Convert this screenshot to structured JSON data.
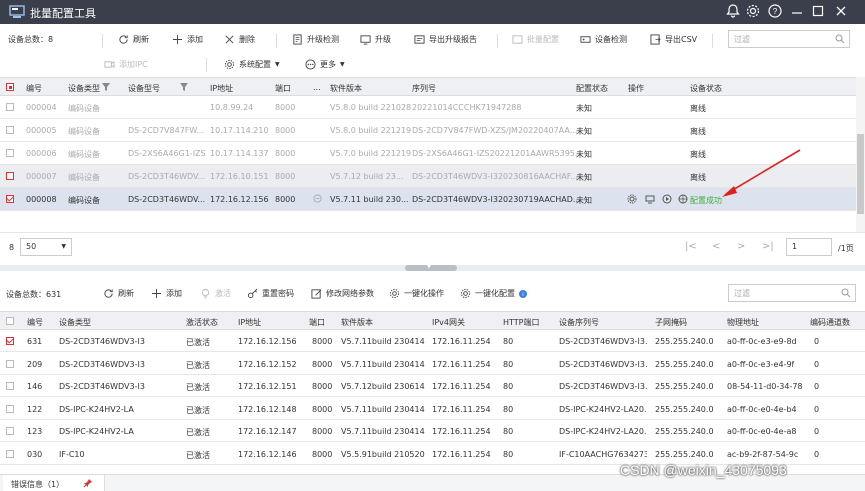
{
  "app": {
    "title": "批量配置工具"
  },
  "toolbar1": {
    "device_total_label": "设备总数：8",
    "refresh": "刷新",
    "add": "添加",
    "delete": "删除",
    "upgrade_check": "升级检测",
    "upgrade": "升级",
    "export_upgrade_report": "导出升级报告",
    "batch_config": "批量配置",
    "device_check": "设备检测",
    "export_csv": "导出CSV",
    "filter_placeholder": "过滤",
    "add_ipc": "添加IPC",
    "system_config": "系统配置",
    "more": "更多"
  },
  "table1": {
    "headers": [
      "编号",
      "设备类型",
      "设备型号",
      "IP地址",
      "端口",
      "...",
      "软件版本",
      "序列号",
      "配置状态",
      "操作",
      "设备状态"
    ],
    "rows": [
      {
        "id": "000004",
        "type": "编码设备",
        "model": "",
        "ip": "10.8.99.24",
        "port": "8000",
        "version": "V5.8.0 build 221028",
        "serial": "20221014CCCHK71947288",
        "config": "未知",
        "status": "离线"
      },
      {
        "id": "000005",
        "type": "编码设备",
        "model": "DS-2CD7V847FW...",
        "ip": "10.17.114.210",
        "port": "8000",
        "version": "V5.8.0 build 221219",
        "serial": "DS-2CD7V847FWD-XZS/JM20220407AA...",
        "config": "未知",
        "status": "离线"
      },
      {
        "id": "000006",
        "type": "编码设备",
        "model": "DS-2XS6A46G1-IZS",
        "ip": "10.17.114.137",
        "port": "8000",
        "version": "V5.7.0 build 221219",
        "serial": "DS-2XS6A46G1-IZS20221201AAWR5395...",
        "config": "未知",
        "status": "离线"
      },
      {
        "id": "000007",
        "type": "编码设备",
        "model": "DS-2CD3T46WDV...",
        "ip": "172.16.10.151",
        "port": "8000",
        "version": "V5.7.12 build 23...",
        "serial": "DS-2CD3T46WDV3-I320230816AACHAF...",
        "config": "未知",
        "status": "离线"
      },
      {
        "id": "000008",
        "type": "编码设备",
        "model": "DS-2CD3T46WDV...",
        "ip": "172.16.12.156",
        "port": "8000",
        "version": "V5.7.11 build 230...",
        "serial": "DS-2CD3T46WDV3-I320230719AACHAD...",
        "config": "未知",
        "status": "配置成功"
      }
    ]
  },
  "pager": {
    "page_size": "50",
    "count": "8",
    "page_input": "1",
    "total_pages": "/1页"
  },
  "toolbar2": {
    "device_total_label": "设备总数：631",
    "refresh": "刷新",
    "add": "添加",
    "activate": "激活",
    "reset_password": "重置密码",
    "modify_network": "修改网络参数",
    "one_key_op": "一键化操作",
    "one_key_config": "一键化配置",
    "filter_placeholder": "过滤"
  },
  "table2": {
    "headers": [
      "编号",
      "设备类型",
      "激活状态",
      "IP地址",
      "端口",
      "软件版本",
      "IPv4网关",
      "HTTP端口",
      "设备序列号",
      "子网掩码",
      "物理地址",
      "编码通道数"
    ],
    "rows": [
      {
        "id": "631",
        "type": "DS-2CD3T46WDV3-I3",
        "act": "已激活",
        "ip": "172.16.12.156",
        "port": "8000",
        "ver": "V5.7.11build 230414",
        "gw": "172.16.11.254",
        "http": "80",
        "serial": "DS-2CD3T46WDV3-I3...",
        "mask": "255.255.240.0",
        "mac": "a0-ff-0c-e3-e9-8d",
        "ch": "0"
      },
      {
        "id": "209",
        "type": "DS-2CD3T46WDV3-I3",
        "act": "已激活",
        "ip": "172.16.12.152",
        "port": "8000",
        "ver": "V5.7.11build 230414",
        "gw": "172.16.11.254",
        "http": "80",
        "serial": "DS-2CD3T46WDV3-I3...",
        "mask": "255.255.240.0",
        "mac": "a0-ff-0c-e3-e4-9f",
        "ch": "0"
      },
      {
        "id": "146",
        "type": "DS-2CD3T46WDV3-I3",
        "act": "已激活",
        "ip": "172.16.12.151",
        "port": "8000",
        "ver": "V5.7.12build 230614",
        "gw": "172.16.11.254",
        "http": "80",
        "serial": "DS-2CD3T46WDV3-I3...",
        "mask": "255.255.240.0",
        "mac": "08-54-11-d0-34-78",
        "ch": "0"
      },
      {
        "id": "122",
        "type": "DS-IPC-K24HV2-LA",
        "act": "已激活",
        "ip": "172.16.12.148",
        "port": "8000",
        "ver": "V5.7.11build 230414",
        "gw": "172.16.11.254",
        "http": "80",
        "serial": "DS-IPC-K24HV2-LA20...",
        "mask": "255.255.240.0",
        "mac": "a0-ff-0c-e0-4e-b4",
        "ch": "0"
      },
      {
        "id": "123",
        "type": "DS-IPC-K24HV2-LA",
        "act": "已激活",
        "ip": "172.16.12.147",
        "port": "8000",
        "ver": "V5.7.11build 230414",
        "gw": "172.16.11.254",
        "http": "80",
        "serial": "DS-IPC-K24HV2-LA20...",
        "mask": "255.255.240.0",
        "mac": "a0-ff-0c-e0-4e-a8",
        "ch": "0"
      },
      {
        "id": "030",
        "type": "IF-C10",
        "act": "已激活",
        "ip": "172.16.12.146",
        "port": "8000",
        "ver": "V5.5.91build 210520",
        "gw": "172.16.11.254",
        "http": "80",
        "serial": "IF-C10AACHG76342731",
        "mask": "255.255.240.0",
        "mac": "ac-b9-2f-87-54-9c",
        "ch": "0"
      }
    ]
  },
  "error_tab": {
    "label": "错误信息（1）"
  },
  "watermark": "CSDN @weixin_43075093",
  "colors": {
    "titlebar": "#3a3f4b",
    "accent_red": "#d33",
    "success": "#3cb034",
    "selected_row": "#dde3ee"
  }
}
